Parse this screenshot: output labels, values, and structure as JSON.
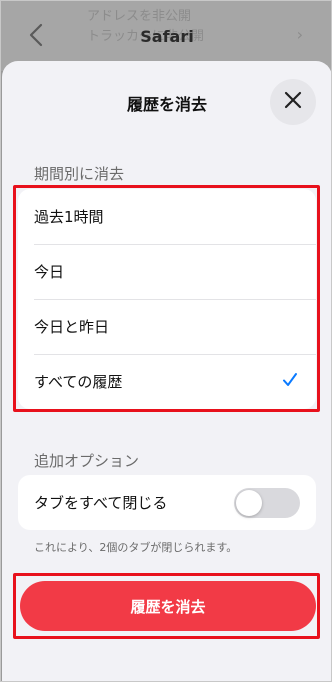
{
  "background": {
    "nav_title": "Safari",
    "behind_text": "アドレスを非公開\nトラッカーに非公開"
  },
  "sheet": {
    "title": "履歴を消去"
  },
  "period_section": {
    "label": "期間別に消去",
    "options": [
      {
        "label": "過去1時間",
        "selected": false
      },
      {
        "label": "今日",
        "selected": false
      },
      {
        "label": "今日と昨日",
        "selected": false
      },
      {
        "label": "すべての履歴",
        "selected": true
      }
    ]
  },
  "options_section": {
    "label": "追加オプション",
    "close_tabs_label": "タブをすべて閉じる",
    "close_tabs_enabled": false,
    "note": "これにより、2個のタブが閉じられます。"
  },
  "action": {
    "clear_label": "履歴を消去"
  },
  "colors": {
    "accent": "#0a7aff",
    "destructive": "#f23a46",
    "highlight": "#e8111c"
  },
  "icons": {
    "back": "chevron-left-icon",
    "close": "close-icon",
    "selected": "checkmark-icon"
  }
}
